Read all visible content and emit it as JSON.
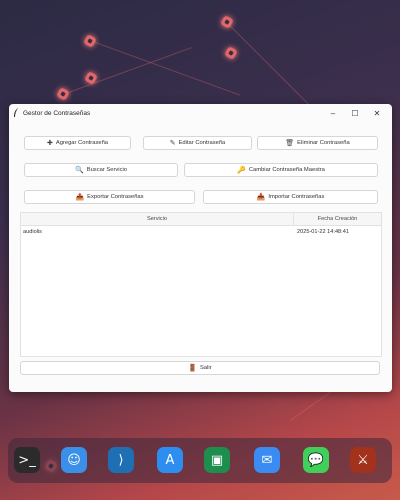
{
  "window": {
    "title": "Gestor de Contraseñas",
    "controls": {
      "minimize": "–",
      "maximize": "☐",
      "close": "✕"
    }
  },
  "buttons": {
    "add": {
      "icon": "✚",
      "label": "Agregar Contraseña"
    },
    "edit": {
      "icon": "✎",
      "label": "Editar Contraseña"
    },
    "delete": {
      "icon": "🗑",
      "label": "Eliminar Contraseña"
    },
    "search": {
      "icon": "🔍",
      "label": "Buscar Servicio"
    },
    "change_master": {
      "icon": "🔑",
      "label": "Cambiar Contraseña Maestra"
    },
    "export": {
      "icon": "📤",
      "label": "Exportar Contraseñas"
    },
    "import": {
      "icon": "📥",
      "label": "Importar Contraseñas"
    },
    "exit": {
      "icon": "🚪",
      "label": "Salir"
    }
  },
  "table": {
    "columns": [
      "Servicio",
      "Fecha Creación"
    ],
    "rows": [
      {
        "service": "audiolis",
        "date": "2025-01-22 14:48:41"
      }
    ]
  },
  "dock": {
    "items": [
      {
        "name": "terminal-icon",
        "glyph": ">_",
        "color": "#2b2b2b"
      },
      {
        "name": "finder-icon",
        "glyph": "☺",
        "color": "#3a8fe8"
      },
      {
        "name": "vscode-icon",
        "glyph": "⟩",
        "color": "#1f6fb5"
      },
      {
        "name": "app-store-icon",
        "glyph": "A",
        "color": "#2d8ef0"
      },
      {
        "name": "classroom-icon",
        "glyph": "▣",
        "color": "#1e8e4e"
      },
      {
        "name": "mail-icon",
        "glyph": "✉",
        "color": "#3b8cf2"
      },
      {
        "name": "messages-icon",
        "glyph": "💬",
        "color": "#3fcf5b"
      },
      {
        "name": "game-icon",
        "glyph": "⚔",
        "color": "#a3321c"
      }
    ]
  }
}
